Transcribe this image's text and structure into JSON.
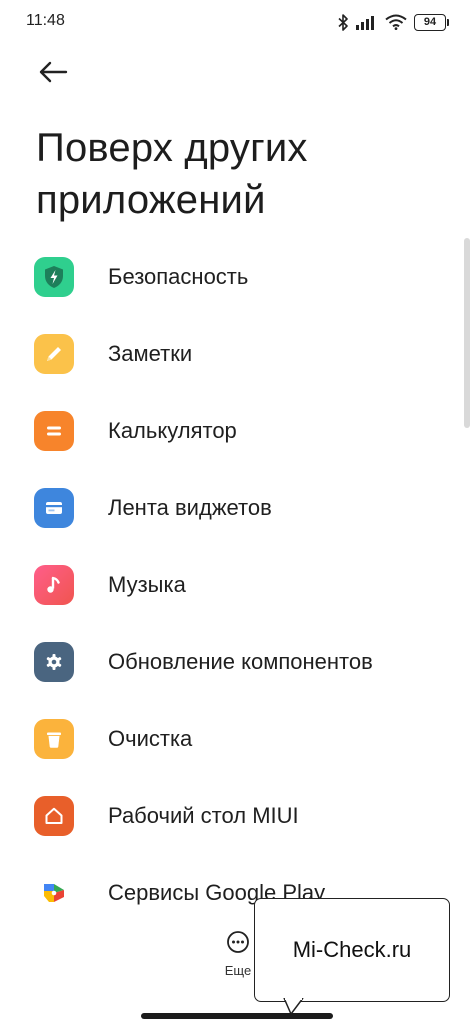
{
  "status_bar": {
    "time": "11:48",
    "battery": "94",
    "icons": [
      "bluetooth-icon",
      "signal-icon",
      "wifi-icon",
      "battery-icon"
    ]
  },
  "header": {
    "back_icon": "arrow-left-icon",
    "title": "Поверх других приложений"
  },
  "apps": [
    {
      "label": "Безопасность",
      "icon": "shield-icon",
      "color": "#2fcf8e"
    },
    {
      "label": "Заметки",
      "icon": "pencil-icon",
      "color": "#fbc24a"
    },
    {
      "label": "Калькулятор",
      "icon": "equals-icon",
      "color": "#f7842b"
    },
    {
      "label": "Лента виджетов",
      "icon": "card-icon",
      "color": "#3e86dd"
    },
    {
      "label": "Музыка",
      "icon": "music-note-icon",
      "color": "#f55a6b"
    },
    {
      "label": "Обновление компонентов",
      "icon": "gear-icon",
      "color": "#4a6580"
    },
    {
      "label": "Очистка",
      "icon": "trash-icon",
      "color": "#fbb33c"
    },
    {
      "label": "Рабочий стол MIUI",
      "icon": "home-icon",
      "color": "#e85f2a"
    },
    {
      "label": "Сервисы Google Play",
      "icon": "google-play-services-icon",
      "color": "#ffffff"
    }
  ],
  "bottom": {
    "more_label": "Еще",
    "more_icon": "more-dots-icon"
  },
  "watermark": {
    "text": "Mi-Check.ru"
  }
}
